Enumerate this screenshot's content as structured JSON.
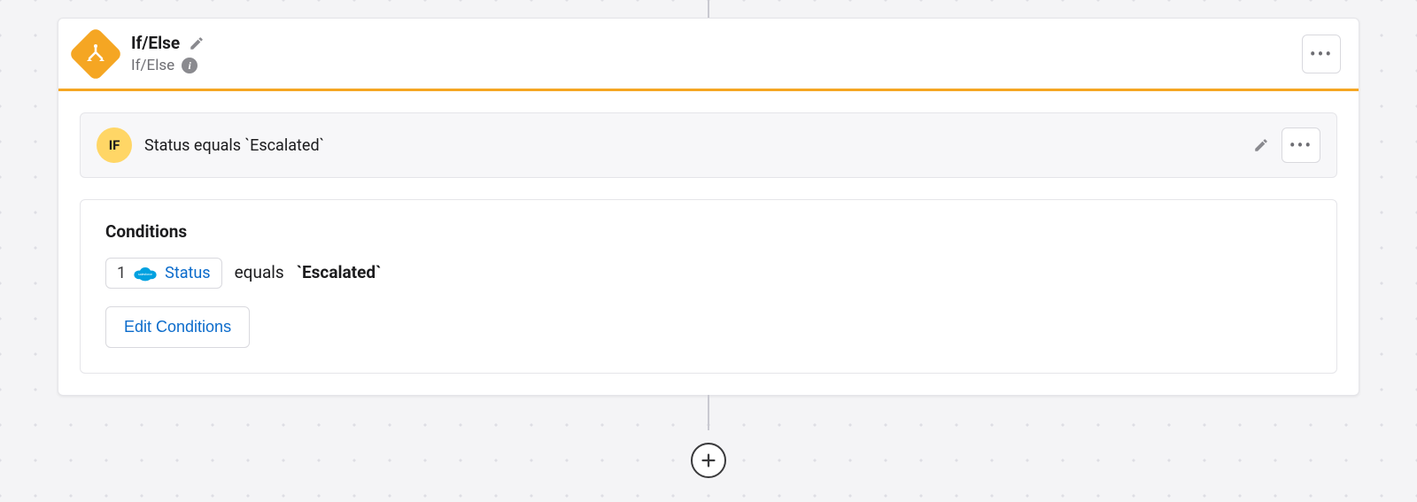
{
  "step": {
    "title": "If/Else",
    "subtitle": "If/Else"
  },
  "branch": {
    "badge": "IF",
    "title": "Status equals `Escalated`"
  },
  "conditions": {
    "heading": "Conditions",
    "row": {
      "index": "1",
      "field": "Status",
      "operator": "equals",
      "value": "`Escalated`"
    },
    "editLabel": "Edit Conditions"
  },
  "icons": {
    "sfBadge": "salesforce"
  }
}
